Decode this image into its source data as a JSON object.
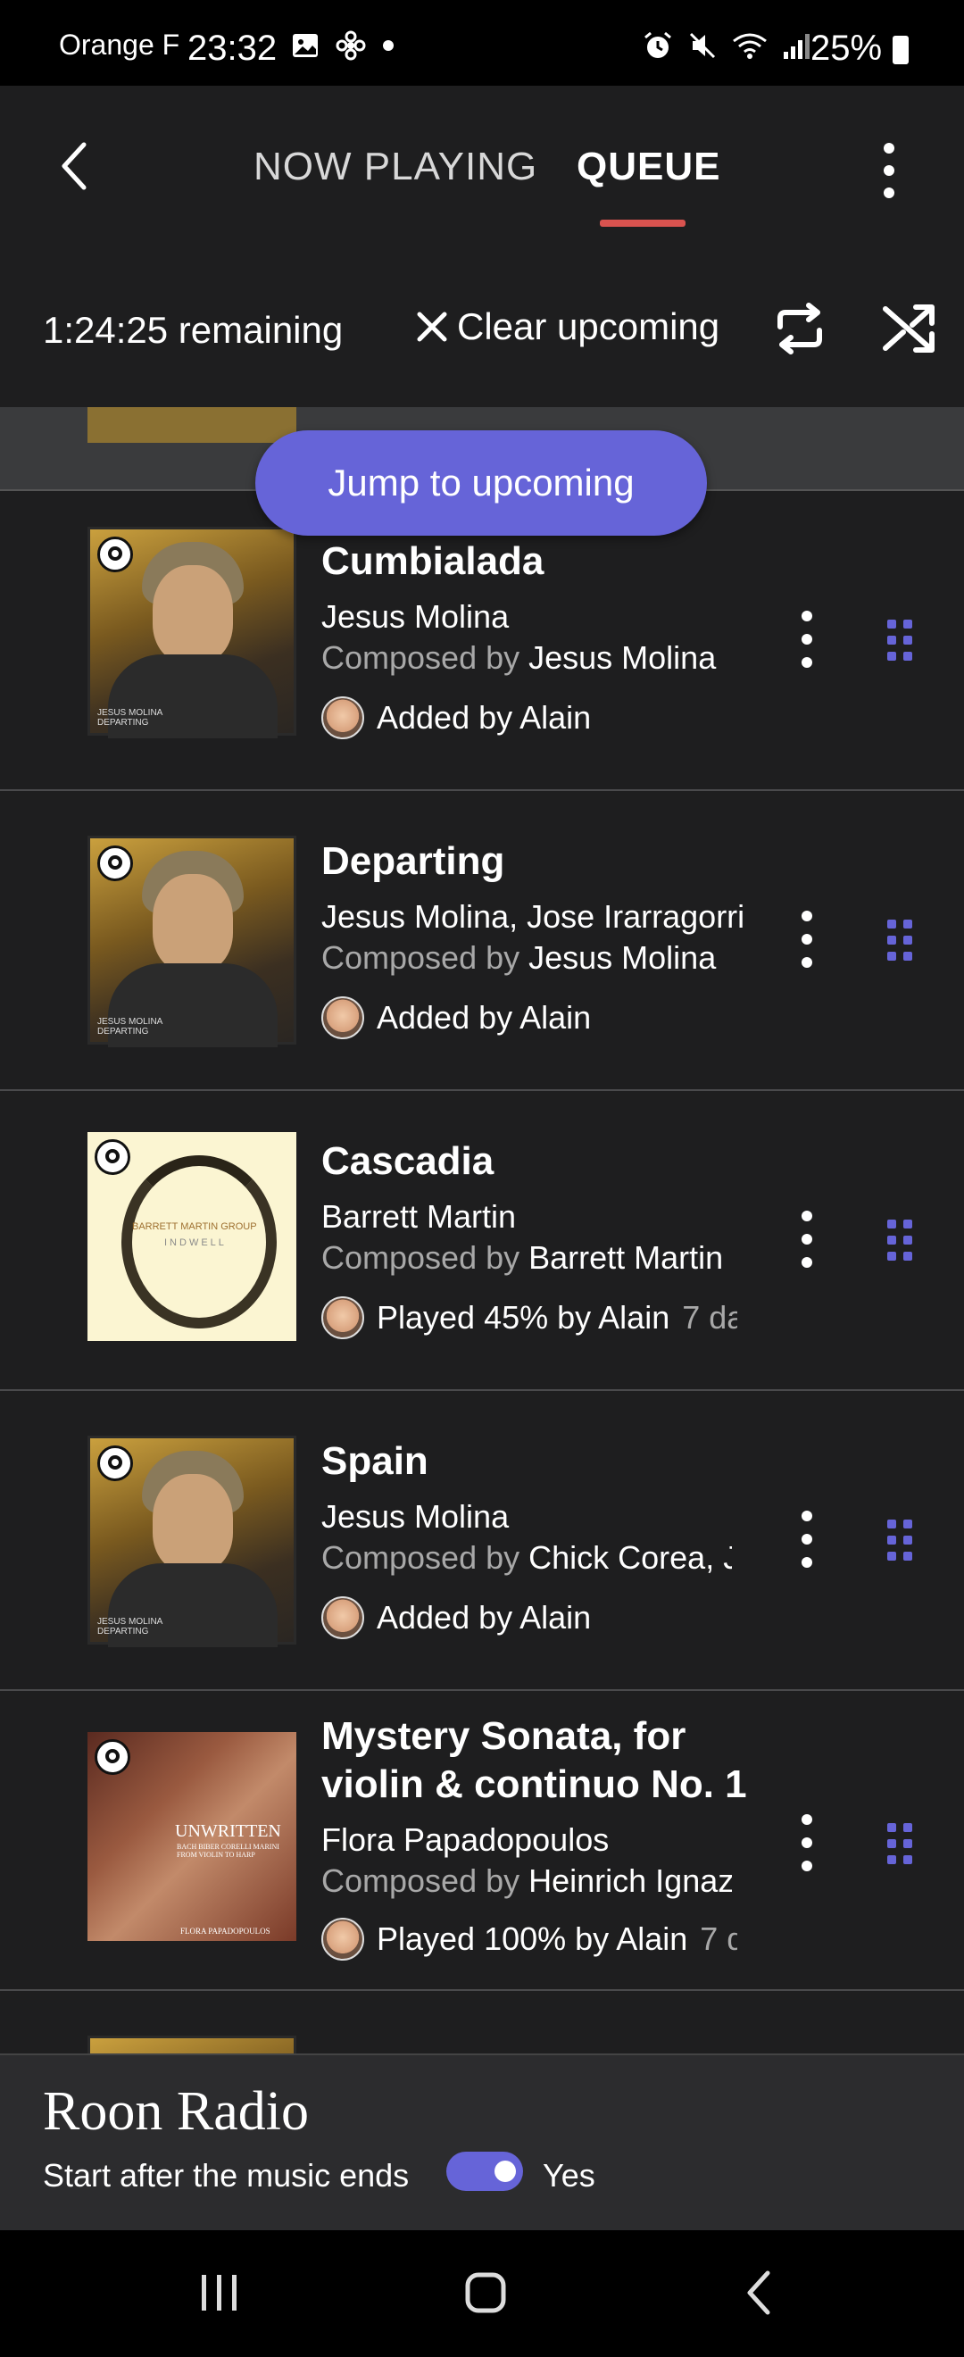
{
  "status_bar": {
    "carrier": "Orange F",
    "time": "23:32",
    "battery": "25%"
  },
  "header": {
    "tabs": [
      {
        "label": "NOW PLAYING",
        "active": false
      },
      {
        "label": "QUEUE",
        "active": true
      }
    ],
    "accent_color": "#d9534f"
  },
  "queue_controls": {
    "remaining": "1:24:25 remaining",
    "clear_label": "Clear upcoming"
  },
  "jump_button": "Jump to upcoming",
  "queue": [
    {
      "title": "Cumbialada",
      "artist": "Jesus Molina",
      "composed_by_prefix": "Composed by ",
      "composer": "Jesus Molina",
      "meta": "Added by Alain",
      "meta_dim": "",
      "art": "portrait"
    },
    {
      "title": "Departing",
      "artist": "Jesus Molina, Jose Irarragorri",
      "composed_by_prefix": "Composed by ",
      "composer": "Jesus Molina",
      "meta": "Added by Alain",
      "meta_dim": "",
      "art": "portrait"
    },
    {
      "title": "Cascadia",
      "artist": "Barrett Martin",
      "composed_by_prefix": "Composed by ",
      "composer": "Barrett Martin",
      "meta": "Played 45% by Alain",
      "meta_dim": "7 da",
      "art": "cream"
    },
    {
      "title": "Spain",
      "artist": "Jesus Molina",
      "composed_by_prefix": "Composed by ",
      "composer": "Chick Corea, Je",
      "meta": "Added by Alain",
      "meta_dim": "",
      "art": "portrait"
    },
    {
      "title_line1": "Mystery Sonata, for",
      "title_line2": "violin & continuo No. 1",
      "artist": "Flora Papadopoulos",
      "composed_by_prefix": "Composed by ",
      "composer": "Heinrich Ignaz",
      "meta": "Played 100% by Alain",
      "meta_dim": "7 d",
      "art": "painting"
    }
  ],
  "album_art_text": {
    "portrait_caption_line1": "JESUS MOLINA",
    "portrait_caption_line2": "DEPARTING",
    "cascadia_line1": "BARRETT MARTIN GROUP",
    "cascadia_line2": "INDWELL",
    "painting_title": "UNWRITTEN",
    "painting_sub1": "BACH BIBER CORELLI MARINI",
    "painting_sub2": "FROM VIOLIN TO HARP",
    "painting_artist": "FLORA PAPADOPOULOS"
  },
  "roon_radio": {
    "title": "Roon Radio",
    "subtitle": "Start after the music ends",
    "toggle_label": "Yes",
    "toggle_on": true,
    "accent_color": "#6664d8"
  }
}
